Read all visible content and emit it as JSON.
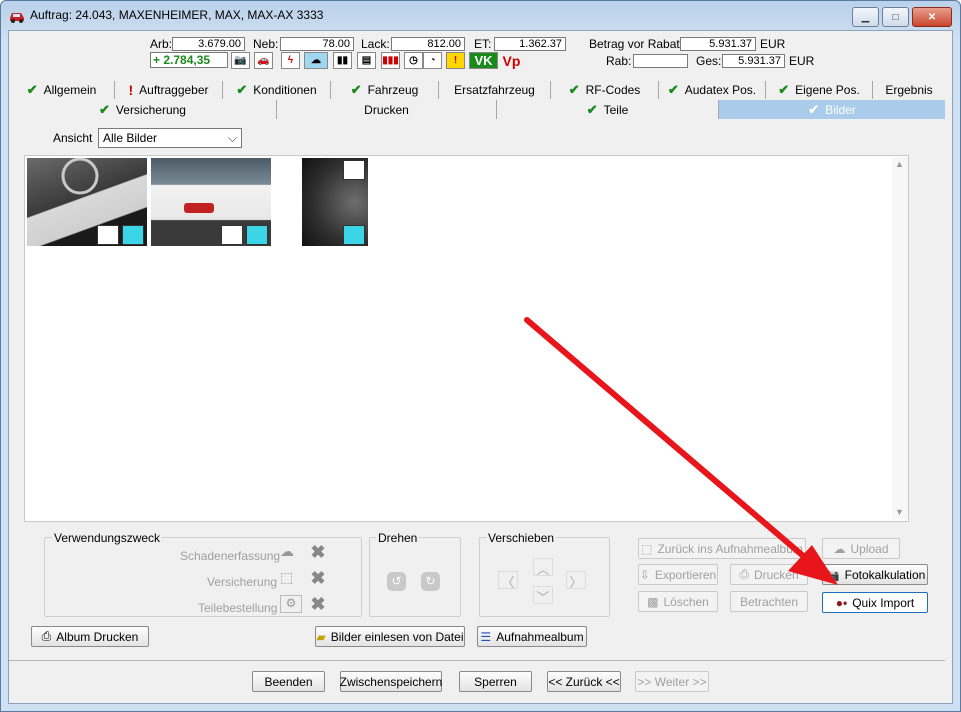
{
  "window": {
    "title": "Auftrag: 24.043, MAXENHEIMER, MAX, MAX-AX 3333"
  },
  "summary": {
    "arb_label": "Arb:",
    "arb_value": "3.679.00",
    "neb_label": "Neb:",
    "neb_value": "78.00",
    "lack_label": "Lack:",
    "lack_value": "812.00",
    "et_label": "ET:",
    "et_value": "1.362.37",
    "balance_value": "+ 2.784,35",
    "betrag_label": "Betrag vor Rabatt:",
    "betrag_value": "5.931.37",
    "betrag_currency": "EUR",
    "rab_label": "Rab:",
    "rab_value": "",
    "ges_label": "Ges:",
    "ges_value": "5.931.37",
    "ges_currency": "EUR",
    "vk_label": "VK",
    "vp_label": "Vp"
  },
  "tabs_row1": [
    {
      "label": "Allgemein",
      "mark": "check"
    },
    {
      "label": "Auftraggeber",
      "mark": "excl"
    },
    {
      "label": "Konditionen",
      "mark": "check"
    },
    {
      "label": "Fahrzeug",
      "mark": "check"
    },
    {
      "label": "Ersatzfahrzeug",
      "mark": ""
    },
    {
      "label": "RF-Codes",
      "mark": "check"
    },
    {
      "label": "Audatex Pos.",
      "mark": "check"
    },
    {
      "label": "Eigene Pos.",
      "mark": "check"
    },
    {
      "label": "Ergebnis",
      "mark": ""
    }
  ],
  "tabs_row2": [
    {
      "label": "Versicherung",
      "mark": "check"
    },
    {
      "label": "Drucken",
      "mark": ""
    },
    {
      "label": "Teile",
      "mark": "check"
    },
    {
      "label": "Bilder",
      "mark": "check",
      "active": true
    }
  ],
  "view": {
    "label": "Ansicht",
    "selected": "Alle Bilder"
  },
  "groups": {
    "usage": {
      "title": "Verwendungszweck",
      "items": [
        "Schadenerfassung",
        "Versicherung",
        "Teilebestellung"
      ]
    },
    "rotate": {
      "title": "Drehen"
    },
    "move": {
      "title": "Verschieben"
    }
  },
  "right_buttons": {
    "back_to_album": "Zurück ins Aufnahmealbum",
    "upload": "Upload",
    "export": "Exportieren",
    "print": "Drucken",
    "photo_calc": "Fotokalkulation",
    "delete": "Löschen",
    "view": "Betrachten",
    "quix_import": "Quix Import"
  },
  "bottom_left": {
    "album_print": "Album Drucken",
    "load_from_file": "Bilder einlesen von Datei",
    "album": "Aufnahmealbum"
  },
  "footer": {
    "quit": "Beenden",
    "save": "Zwischenspeichern",
    "lock": "Sperren",
    "back": "<< Zurück <<",
    "next": ">> Weiter >>"
  },
  "colors": {
    "active_tab": "#aacbe9",
    "arrow": "#e8161b",
    "check": "#1a8a1a",
    "balance": "#1a8a1a"
  }
}
